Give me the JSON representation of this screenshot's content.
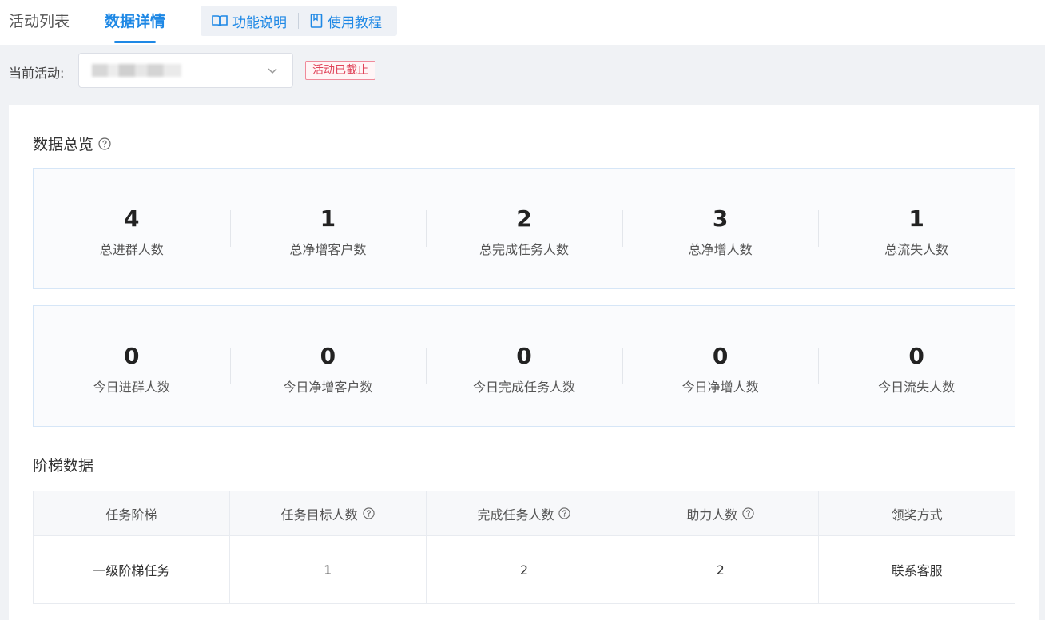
{
  "tabs": [
    {
      "label": "活动列表",
      "active": false
    },
    {
      "label": "数据详情",
      "active": true
    }
  ],
  "help_links": {
    "feature_label": "功能说明",
    "tutorial_label": "使用教程"
  },
  "filter": {
    "label": "当前活动:",
    "status_tag": "活动已截止"
  },
  "overview": {
    "title": "数据总览",
    "totals": [
      {
        "value": "4",
        "label": "总进群人数"
      },
      {
        "value": "1",
        "label": "总净增客户数"
      },
      {
        "value": "2",
        "label": "总完成任务人数"
      },
      {
        "value": "3",
        "label": "总净增人数"
      },
      {
        "value": "1",
        "label": "总流失人数"
      }
    ],
    "today": [
      {
        "value": "0",
        "label": "今日进群人数"
      },
      {
        "value": "0",
        "label": "今日净增客户数"
      },
      {
        "value": "0",
        "label": "今日完成任务人数"
      },
      {
        "value": "0",
        "label": "今日净增人数"
      },
      {
        "value": "0",
        "label": "今日流失人数"
      }
    ]
  },
  "ladder": {
    "title": "阶梯数据",
    "columns": [
      "任务阶梯",
      "任务目标人数",
      "完成任务人数",
      "助力人数",
      "领奖方式"
    ],
    "rows": [
      [
        "一级阶梯任务",
        "1",
        "2",
        "2",
        "联系客服"
      ]
    ]
  },
  "colors": {
    "accent": "#1e88e5",
    "danger": "#e0445a"
  }
}
